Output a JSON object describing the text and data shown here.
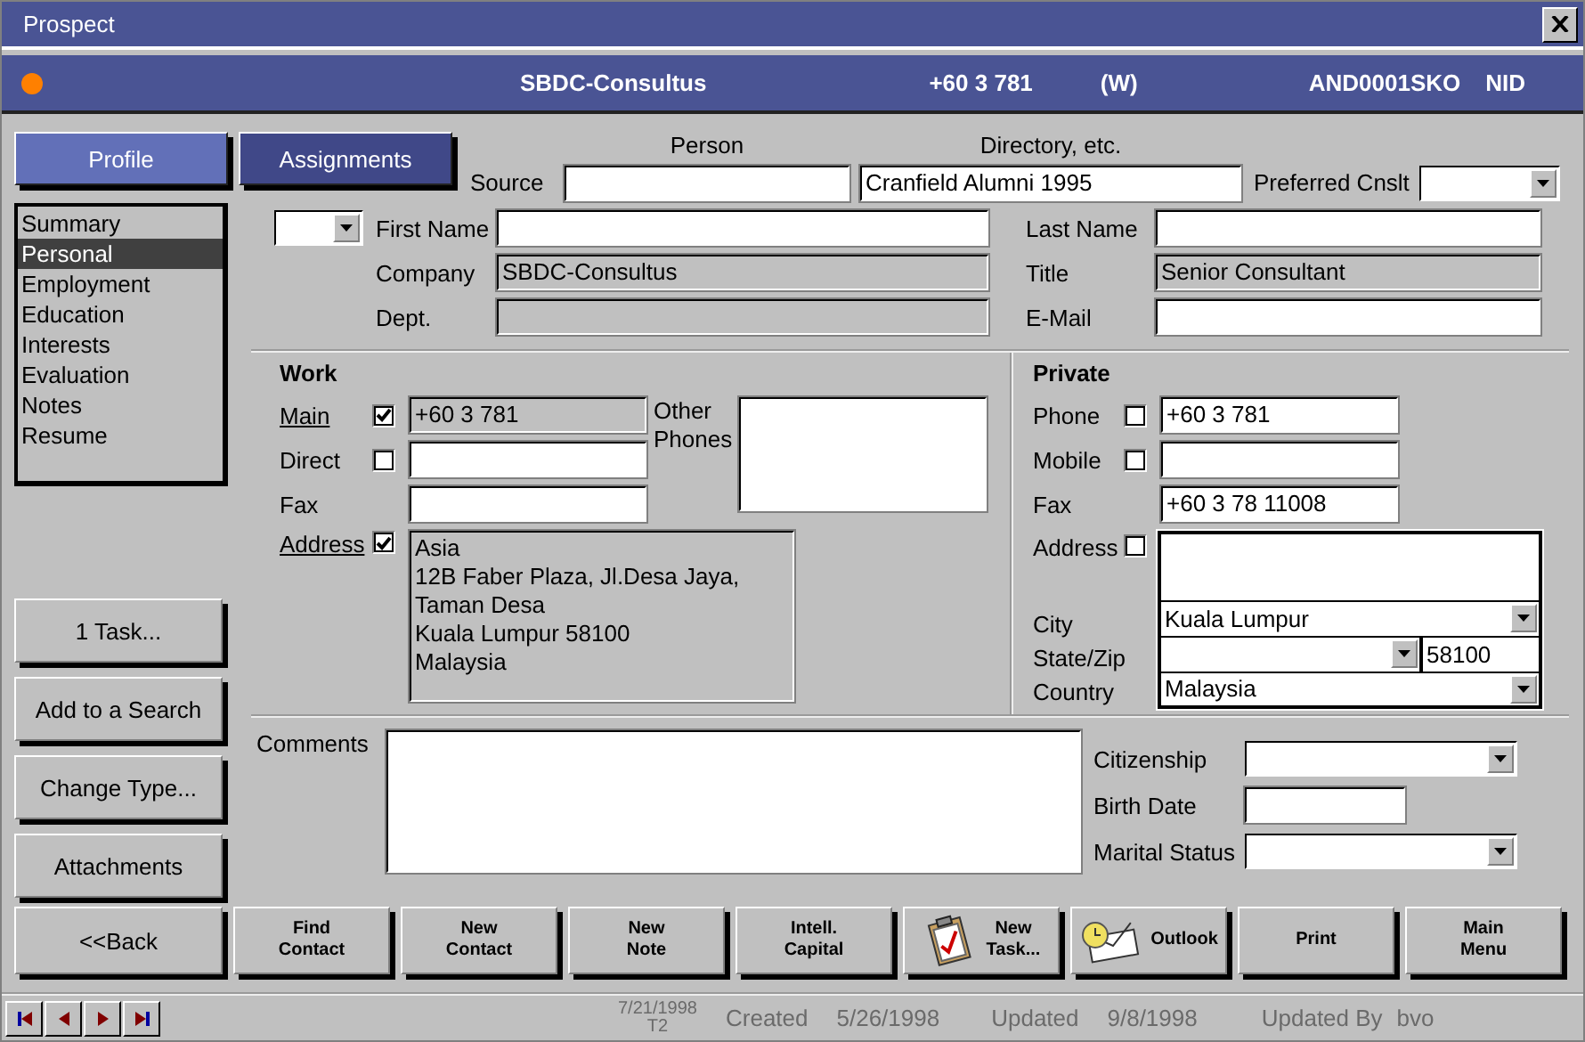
{
  "window": {
    "title": "Prospect"
  },
  "header": {
    "company": "SBDC-Consultus",
    "phone": "+60 3 781",
    "phone_type": "(W)",
    "code": "AND0001SKO",
    "type": "NID"
  },
  "tabs": [
    {
      "label": "Profile",
      "selected": true
    },
    {
      "label": "Assignments",
      "selected": false
    }
  ],
  "source": {
    "label": "Source",
    "person_caption": "Person",
    "directory_caption": "Directory, etc.",
    "directory_value": "Cranfield Alumni 1995",
    "preferred_label": "Preferred Cnslt"
  },
  "sections": [
    {
      "label": "Summary",
      "selected": false
    },
    {
      "label": "Personal",
      "selected": true
    },
    {
      "label": "Employment",
      "selected": false
    },
    {
      "label": "Education",
      "selected": false
    },
    {
      "label": "Interests",
      "selected": false
    },
    {
      "label": "Evaluation",
      "selected": false
    },
    {
      "label": "Notes",
      "selected": false
    },
    {
      "label": "Resume",
      "selected": false
    }
  ],
  "side_buttons": [
    "1 Task...",
    "Add to a Search",
    "Change Type...",
    "Attachments"
  ],
  "identity": {
    "left": [
      {
        "label": "First Name",
        "kind": "edit",
        "prefix_dropdown": true
      },
      {
        "label": "Company",
        "kind": "readonly",
        "value": "SBDC-Consultus",
        "prefix_dropdown": false
      },
      {
        "label": "Dept.",
        "kind": "readonly",
        "prefix_dropdown": false
      }
    ],
    "right": [
      {
        "label": "Last Name",
        "kind": "edit"
      },
      {
        "label": "Title",
        "kind": "readonly",
        "value": "Senior Consultant"
      },
      {
        "label": "E-Mail",
        "kind": "edit"
      }
    ]
  },
  "work": {
    "heading": "Work",
    "phones": [
      {
        "label": "Main",
        "link": true,
        "checked": true,
        "kind": "readonly",
        "value": "+60 3 781"
      },
      {
        "label": "Direct",
        "link": false,
        "checked": false,
        "kind": "edit"
      },
      {
        "label": "Fax",
        "link": false,
        "kind": "edit"
      }
    ],
    "other_phones_label": "Other Phones",
    "address": {
      "label": "Address",
      "link": true,
      "checked": true,
      "lines": [
        "Asia",
        "12B Faber Plaza, Jl.Desa Jaya,",
        "Taman Desa",
        "Kuala Lumpur  58100",
        "Malaysia"
      ]
    }
  },
  "private": {
    "heading": "Private",
    "phones": [
      {
        "label": "Phone",
        "checked": false,
        "value": "+60 3 781"
      },
      {
        "label": "Mobile",
        "checked": false
      },
      {
        "label": "Fax",
        "value": "+60 3 78 11008"
      }
    ],
    "address": {
      "label": "Address",
      "checked": false,
      "city_label": "City",
      "city": "Kuala Lumpur",
      "state_zip_label": "State/Zip",
      "zip": "58100",
      "country_label": "Country",
      "country": "Malaysia"
    }
  },
  "comments": {
    "label": "Comments"
  },
  "details": [
    {
      "label": "Citizenship",
      "kind": "dropdown"
    },
    {
      "label": "Birth Date",
      "kind": "edit"
    },
    {
      "label": "Marital Status",
      "kind": "dropdown"
    }
  ],
  "back_button": "<<Back",
  "actions": [
    {
      "lines": [
        "Find",
        "Contact"
      ],
      "kind": "plain"
    },
    {
      "lines": [
        "New",
        "Contact"
      ],
      "kind": "plain"
    },
    {
      "lines": [
        "New",
        "Note"
      ],
      "kind": "plain"
    },
    {
      "lines": [
        "Intell.",
        "Capital"
      ],
      "kind": "plain"
    },
    {
      "lines": [
        "New",
        "Task..."
      ],
      "kind": "clipboard"
    },
    {
      "lines": [
        "Outlook"
      ],
      "kind": "mail"
    },
    {
      "lines": [
        "Print"
      ],
      "kind": "plain"
    },
    {
      "lines": [
        "Main",
        "Menu"
      ],
      "kind": "plain"
    }
  ],
  "status": {
    "date": "7/21/1998",
    "terminal": "T2",
    "created_label": "Created",
    "created": "5/26/1998",
    "updated_label": "Updated",
    "updated": "9/8/1998",
    "updated_by_label": "Updated By",
    "updated_by": "bvo"
  }
}
